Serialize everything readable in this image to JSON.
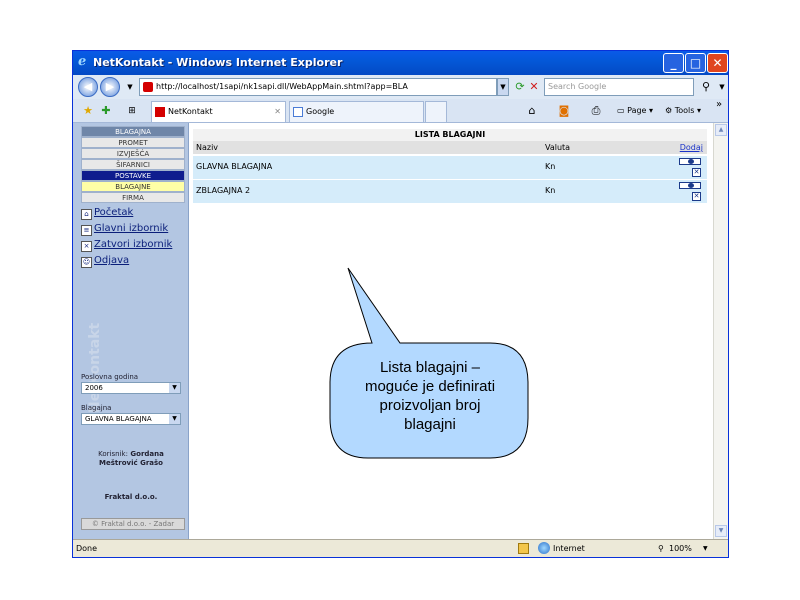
{
  "window": {
    "title": "NetKontakt - Windows Internet Explorer",
    "min_glyph": "_",
    "max_glyph": "□",
    "close_glyph": "✕"
  },
  "address": {
    "url": "http://localhost/1sapi/nk1sapi.dll/WebAppMain.shtml?app=BLA",
    "search_placeholder": "Search Google"
  },
  "tabs": [
    {
      "label": "NetKontakt",
      "close": "✕"
    },
    {
      "label": "Google"
    }
  ],
  "commands": {
    "page": "Page",
    "tools": "Tools",
    "more": "»"
  },
  "sidebar": {
    "menu": [
      {
        "label": "BLAGAJNA"
      },
      {
        "label": "PROMET"
      },
      {
        "label": "IZVJEŠĆA"
      },
      {
        "label": "ŠIFARNICI"
      },
      {
        "label": "POSTAVKE"
      },
      {
        "label": "BLAGAJNE"
      },
      {
        "label": "FIRMA"
      }
    ],
    "links": [
      {
        "label": "Početak"
      },
      {
        "label": "Glavni izbornik"
      },
      {
        "label": "Zatvori izbornik"
      },
      {
        "label": "Odjava"
      }
    ],
    "poslovna_godina_label": "Poslovna godina",
    "poslovna_godina_value": "2006",
    "blagajna_label": "Blagajna",
    "blagajna_value": "GLAVNA BLAGAJNA",
    "korisnik_label": "Korisnik:",
    "korisnik_name_1": "Gordana",
    "korisnik_name_2": "Meštrović Grašo",
    "company": "Fraktal d.o.o.",
    "copyright": "© Fraktal d.o.o. - Zadar"
  },
  "main": {
    "title": "LISTA BLAGAJNI",
    "columns": {
      "naziv": "Naziv",
      "valuta": "Valuta",
      "dodaj": "Dodaj"
    },
    "rows": [
      {
        "naziv": "GLAVNA BLAGAJNA",
        "valuta": "Kn"
      },
      {
        "naziv": "ZBLAGAJNA 2",
        "valuta": "Kn"
      }
    ]
  },
  "status": {
    "left": "Done",
    "zone": "Internet",
    "zoom": "100%"
  },
  "callout": {
    "lines": [
      "Lista blagajni –",
      "moguće je definirati",
      "proizvoljan broj",
      "blagajni"
    ],
    "fill": "#b3d9ff",
    "stroke": "#000000"
  }
}
